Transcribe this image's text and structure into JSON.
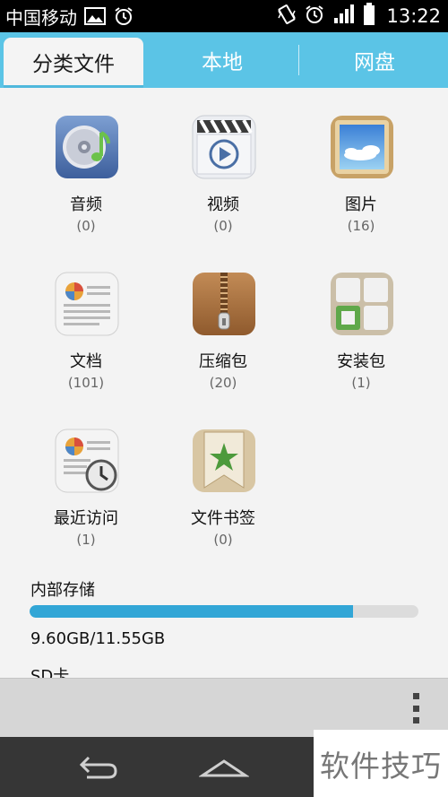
{
  "status_bar": {
    "carrier": "中国移动",
    "time": "13:22",
    "icons": [
      "image-icon",
      "alarm-icon",
      "vibrate-icon",
      "alarm-icon",
      "signal-icon",
      "battery-icon"
    ]
  },
  "tabs": [
    {
      "label": "分类文件",
      "active": true
    },
    {
      "label": "本地",
      "active": false
    },
    {
      "label": "网盘",
      "active": false
    }
  ],
  "categories": [
    {
      "label": "音频",
      "count": "(0)",
      "icon": "music-disc-icon"
    },
    {
      "label": "视频",
      "count": "(0)",
      "icon": "video-clapper-icon"
    },
    {
      "label": "图片",
      "count": "(16)",
      "icon": "picture-icon"
    },
    {
      "label": "文档",
      "count": "(101)",
      "icon": "document-icon"
    },
    {
      "label": "压缩包",
      "count": "(20)",
      "icon": "zip-archive-icon"
    },
    {
      "label": "安装包",
      "count": "(1)",
      "icon": "install-package-icon"
    },
    {
      "label": "最近访问",
      "count": "(1)",
      "icon": "recent-clock-icon"
    },
    {
      "label": "文件书签",
      "count": "(0)",
      "icon": "bookmark-star-icon"
    }
  ],
  "storage": {
    "title": "内部存储",
    "size": "9.60GB/11.55GB",
    "used_fraction": 0.831,
    "sd_label": "SD卡"
  },
  "watermark": "软件技巧",
  "colors": {
    "accent": "#5bc4e6",
    "storage_bar": "#32a6d6"
  }
}
